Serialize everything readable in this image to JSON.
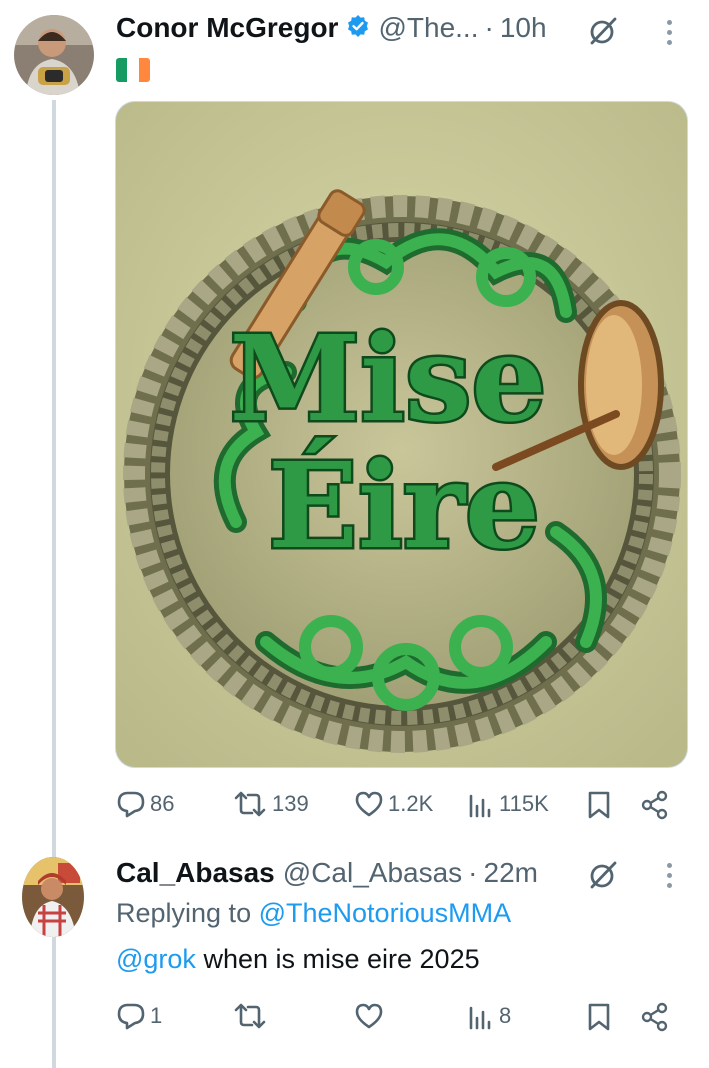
{
  "colors": {
    "link": "#1d9bf0",
    "secondary_text": "#536471",
    "verified_badge": "#1d9bf0",
    "flag_green": "#169b62",
    "flag_white": "#ffffff",
    "flag_orange": "#ff883e",
    "celtic_green": "#2e9a45"
  },
  "tweet": {
    "author": {
      "name": "Conor McGregor",
      "handle": "@The...",
      "avatar": "conor-avatar",
      "verified": true
    },
    "separator": "·",
    "time": "10h",
    "body_icon": "ireland-flag",
    "image_text": {
      "line1": "Mise",
      "line2": "Éire"
    },
    "actions": {
      "replies": "86",
      "retweets": "139",
      "likes": "1.2K",
      "views": "115K"
    }
  },
  "reply": {
    "author": {
      "name": "Cal_Abasas",
      "handle": "@Cal_Abasas",
      "avatar": "cal-avatar"
    },
    "separator": "·",
    "time": "22m",
    "replying_to_label": "Replying to",
    "replying_to_handle": "@TheNotoriousMMA",
    "mention": "@grok",
    "text": "when is mise eire 2025",
    "actions": {
      "replies": "1",
      "retweets": "",
      "likes": "",
      "views": "8"
    }
  },
  "icons": [
    "grok-icon",
    "more-icon",
    "reply-icon",
    "retweet-icon",
    "like-icon",
    "views-icon",
    "bookmark-icon",
    "share-icon",
    "verified-badge-icon"
  ]
}
